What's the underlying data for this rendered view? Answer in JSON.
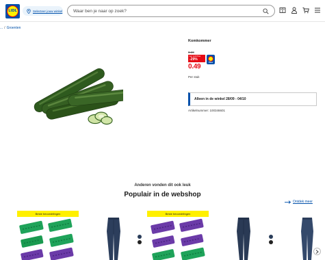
{
  "header": {
    "logo_text": "LIDL",
    "store_label": "Selecteer jouw winkel",
    "search_placeholder": "Waar ben je naar op zoek?",
    "icons": [
      "brochure-icon",
      "account-icon",
      "cart-icon",
      "menu-icon"
    ]
  },
  "breadcrumb": {
    "prefix": "...",
    "separator": "/",
    "current": "Groenten"
  },
  "product": {
    "title": "Komkommer",
    "old_price": "0.69",
    "badge_line1": "met Lidl Plus",
    "badge_line2": "-29%",
    "lidl_plus_label": "Plus",
    "price": "0.49",
    "per_unit": "Per stuk",
    "availability": "Alleen in de winkel 28/09 - 04/10",
    "article_number": "Artikelnummer: 100346601"
  },
  "recommendations": {
    "subheading": "Anderen vonden dit ook leuk",
    "heading": "Populair in de webshop",
    "discover_link": "Ontdek meer",
    "best_seller_badge": "Beste beoordelingen"
  },
  "colors": {
    "brand_blue": "#0050aa",
    "brand_yellow": "#fff000",
    "brand_red": "#e60a14"
  }
}
